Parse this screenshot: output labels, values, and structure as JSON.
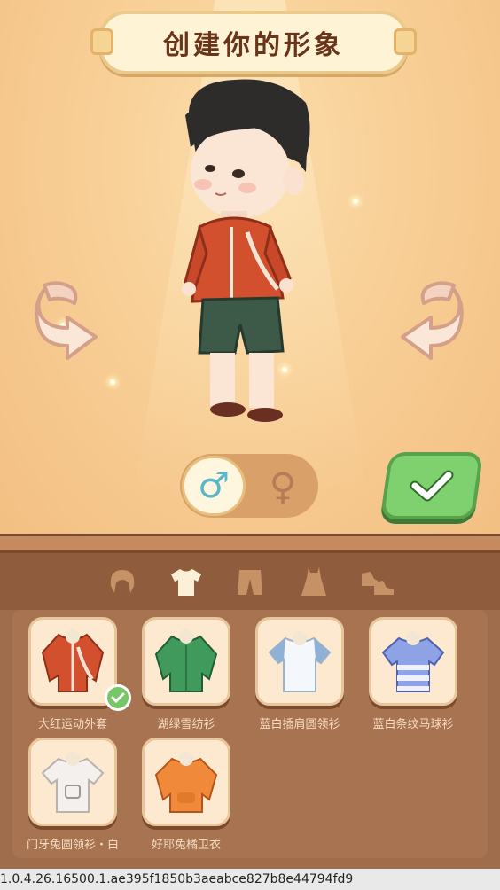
{
  "header": {
    "title": "创建你的形象"
  },
  "colors": {
    "accent_green": "#7fd06f",
    "panel_brown": "#a06d4c",
    "title_brown": "#6a3418"
  },
  "gender": {
    "male_symbol": "♂",
    "female_symbol": "♀",
    "selected": "male"
  },
  "tabs": [
    {
      "icon": "hair-icon"
    },
    {
      "icon": "shirt-icon",
      "active": true
    },
    {
      "icon": "pants-icon"
    },
    {
      "icon": "dress-icon"
    },
    {
      "icon": "shoes-icon"
    }
  ],
  "items": [
    {
      "label": "大红运动外套",
      "color": "#d2502e",
      "selected": true
    },
    {
      "label": "湖绿雪纺衫",
      "color": "#3f9a5c"
    },
    {
      "label": "蓝白插肩圆领衫",
      "color": "#e8f0f6"
    },
    {
      "label": "蓝白条纹马球衫",
      "color": "#8da3e6"
    },
    {
      "label": "门牙兔圆领衫・白",
      "color": "#f3f0ee"
    },
    {
      "label": "好耶兔橘卫衣",
      "color": "#f08a3a"
    }
  ],
  "footer": {
    "version": "1.0.4.26.16500.1.ae395f1850b3aeabce827b8e44794fd9"
  }
}
